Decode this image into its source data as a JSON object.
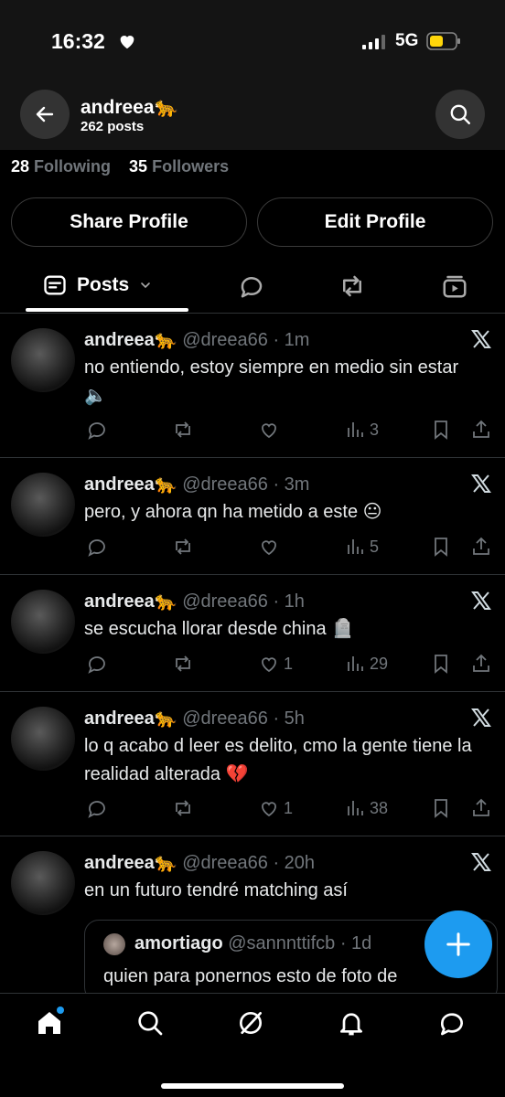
{
  "status_bar": {
    "time": "16:32",
    "network": "5G",
    "battery_color": "#ffd60a"
  },
  "header": {
    "name": "andreea🐆",
    "posts_count": "262 posts"
  },
  "profile": {
    "following_count": "28",
    "following_label": "Following",
    "followers_count": "35",
    "followers_label": "Followers",
    "share_button": "Share Profile",
    "edit_button": "Edit Profile"
  },
  "tabs": {
    "active_label": "Posts"
  },
  "tweets": [
    {
      "name": "andreea🐆",
      "handle": "@dreea66 · 1m",
      "text": "no entiendo, estoy siempre en medio sin estar🔈",
      "likes": "",
      "views": "3"
    },
    {
      "name": "andreea🐆",
      "handle": "@dreea66 · 3m",
      "text": "pero, y ahora qn ha metido a este 😐",
      "likes": "",
      "views": "5"
    },
    {
      "name": "andreea🐆",
      "handle": "@dreea66 · 1h",
      "text": "se escucha llorar desde china 🪦",
      "likes": "1",
      "views": "29"
    },
    {
      "name": "andreea🐆",
      "handle": "@dreea66 · 5h",
      "text": "lo q acabo d leer es delito, cmo la gente tiene la realidad alterada 💔",
      "likes": "1",
      "views": "38"
    },
    {
      "name": "andreea🐆",
      "handle": "@dreea66 · 20h",
      "text": "en un futuro tendré matching así",
      "likes": "",
      "views": ""
    }
  ],
  "quote": {
    "name": "amortiago",
    "handle": "@sannnttifcb · 1d",
    "text": "quien para ponernos esto de foto de"
  },
  "colors": {
    "accent": "#1d9bf0",
    "muted": "#71767b"
  },
  "nav_icons": [
    "home-icon",
    "search-icon",
    "grok-icon",
    "notifications-icon",
    "messages-icon"
  ]
}
